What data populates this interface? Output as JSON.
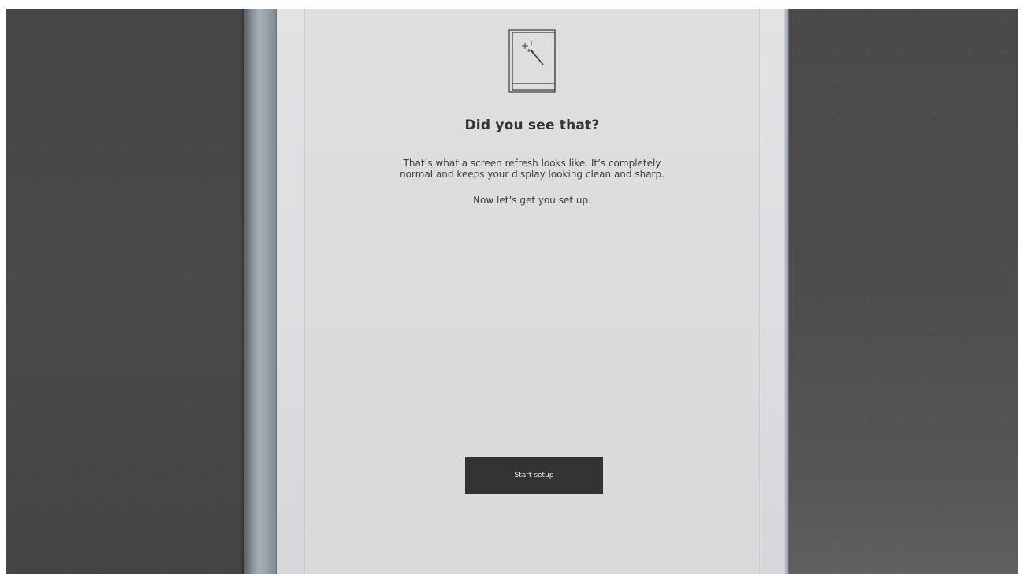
{
  "onboarding": {
    "icon": "magic-wand-tablet-icon",
    "heading": "Did you see that?",
    "paragraph_line1": "That’s what a screen refresh looks like. It’s completely",
    "paragraph_line2": "normal and keeps your display looking clean and sharp.",
    "paragraph2": "Now let’s get you set up.",
    "start_button_label": "Start setup"
  },
  "colors": {
    "desk": "#484848",
    "screen": "#dcdcdd",
    "button": "#333333",
    "button_text": "#ececec",
    "text": "#333333"
  }
}
